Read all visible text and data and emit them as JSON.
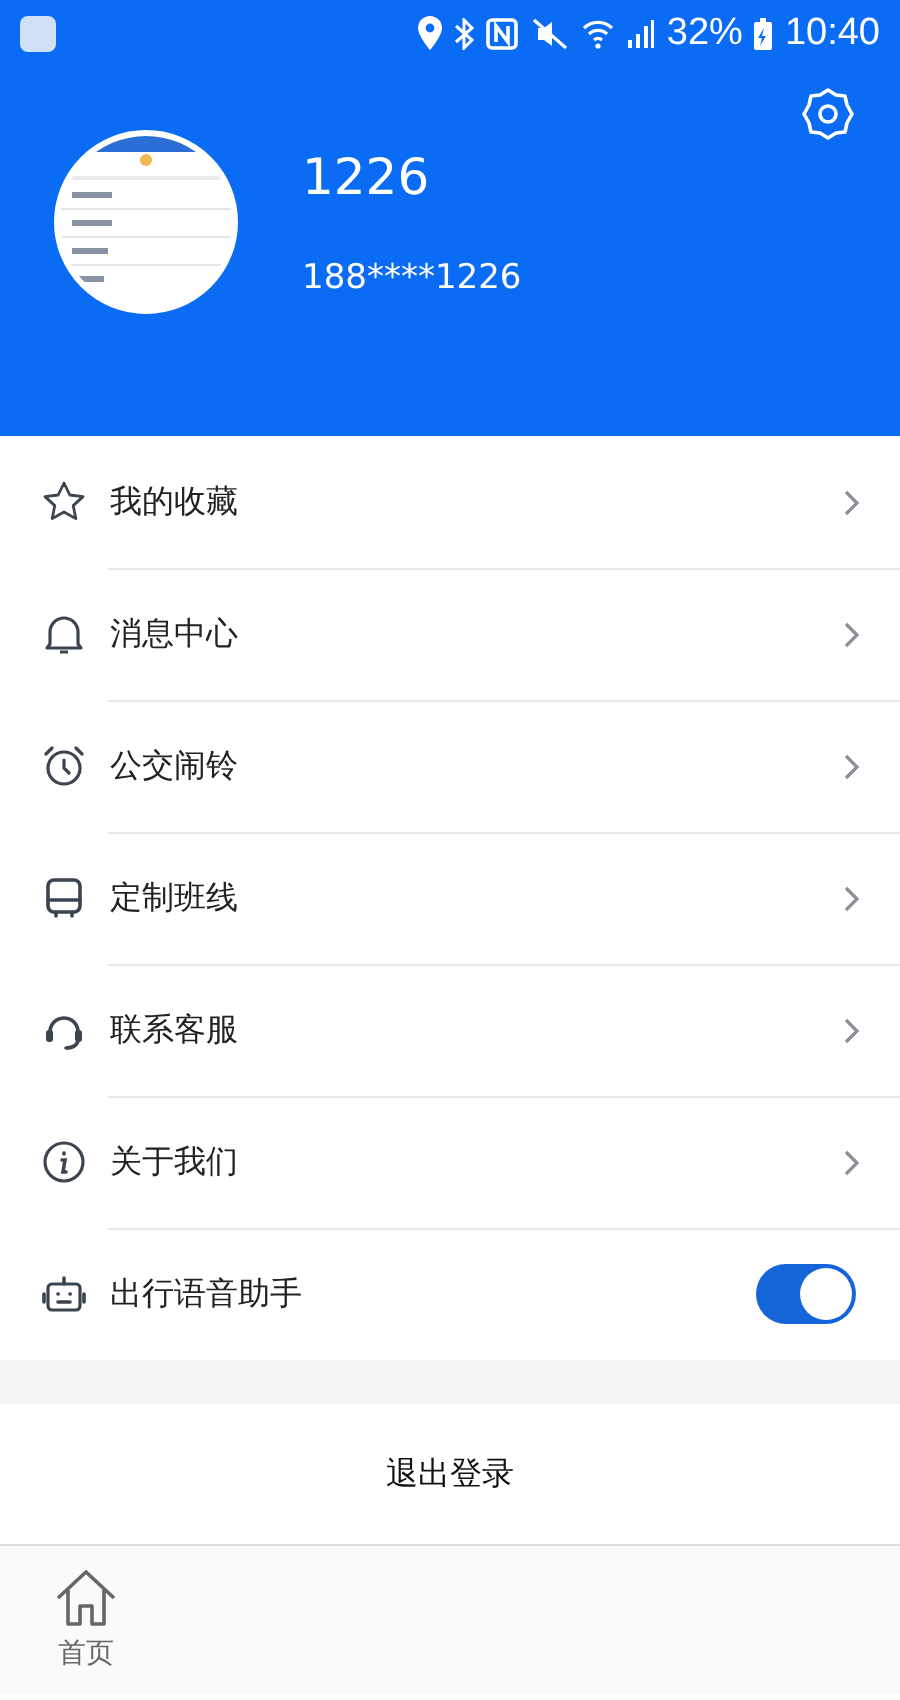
{
  "status_bar": {
    "battery": "32%",
    "time": "10:40"
  },
  "profile": {
    "name": "1226",
    "phone": "188****1226"
  },
  "menu": [
    {
      "label": "我的收藏",
      "kind": "link"
    },
    {
      "label": "消息中心",
      "kind": "link"
    },
    {
      "label": "公交闹铃",
      "kind": "link"
    },
    {
      "label": "定制班线",
      "kind": "link"
    },
    {
      "label": "联系客服",
      "kind": "link"
    },
    {
      "label": "关于我们",
      "kind": "link"
    },
    {
      "label": "出行语音助手",
      "kind": "toggle",
      "on": true
    }
  ],
  "logout": "退出登录",
  "tab_bar": [
    {
      "label": "首页",
      "selected": false
    }
  ]
}
